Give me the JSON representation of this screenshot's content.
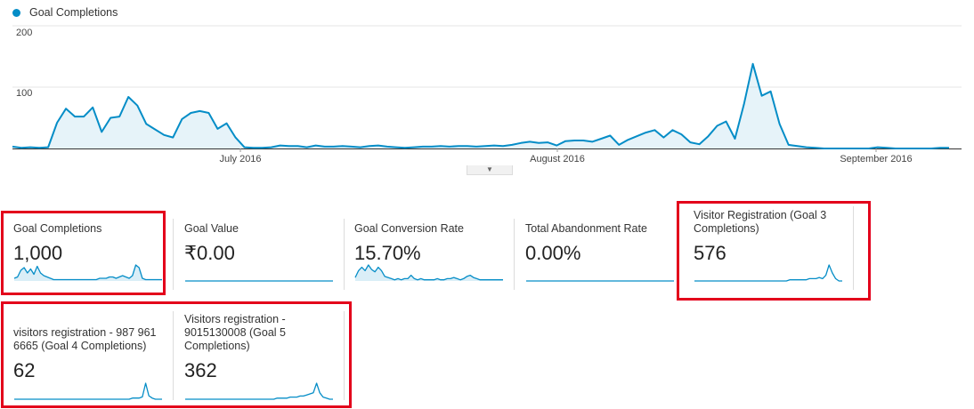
{
  "legend": {
    "label": "Goal Completions",
    "color": "#058dc7"
  },
  "chart_data": {
    "type": "area",
    "series": [
      {
        "name": "Goal Completions",
        "values": [
          3,
          1,
          2,
          1,
          2,
          42,
          65,
          52,
          52,
          67,
          27,
          50,
          52,
          84,
          70,
          40,
          31,
          22,
          18,
          48,
          58,
          61,
          58,
          32,
          41,
          18,
          2,
          1,
          1,
          2,
          5,
          4,
          4,
          2,
          5,
          3,
          3,
          4,
          3,
          2,
          4,
          5,
          3,
          2,
          1,
          2,
          3,
          3,
          4,
          3,
          4,
          4,
          3,
          4,
          5,
          4,
          6,
          9,
          11,
          9,
          10,
          5,
          12,
          13,
          13,
          11,
          16,
          21,
          6,
          14,
          20,
          26,
          30,
          18,
          30,
          23,
          10,
          7,
          20,
          37,
          44,
          16,
          72,
          138,
          86,
          93,
          40,
          6,
          4,
          2,
          1,
          0,
          0,
          0,
          0,
          0,
          0,
          2,
          1,
          0,
          0,
          0,
          0,
          0,
          1,
          1
        ]
      }
    ],
    "x_ticks": [
      "July 2016",
      "August 2016",
      "September 2016"
    ],
    "y_ticks": [
      "200",
      "100"
    ],
    "ylim": [
      0,
      200
    ]
  },
  "metrics": [
    {
      "label": "Goal Completions",
      "value": "1,000"
    },
    {
      "label": "Goal Value",
      "value": "₹0.00"
    },
    {
      "label": "Goal Conversion Rate",
      "value": "15.70%"
    },
    {
      "label": "Total Abandonment Rate",
      "value": "0.00%"
    },
    {
      "label": "Visitor Registration (Goal 3 Completions)",
      "value": "576"
    },
    {
      "label": "visitors registration - 987 961 6665 (Goal 4 Completions)",
      "value": "62"
    },
    {
      "label": "Visitors registration - 9015130008 (Goal 5 Completions)",
      "value": "362"
    }
  ],
  "sparklines": [
    {
      "type": "area",
      "values": [
        2,
        3,
        8,
        10,
        6,
        9,
        5,
        11,
        6,
        4,
        3,
        2,
        1,
        1,
        1,
        1,
        1,
        1,
        1,
        1,
        1,
        1,
        1,
        1,
        1,
        1,
        2,
        2,
        2,
        3,
        3,
        2,
        3,
        4,
        3,
        2,
        4,
        12,
        10,
        2,
        1,
        1,
        1,
        1,
        1,
        1
      ]
    },
    {
      "type": "line",
      "values": [
        0,
        0,
        0,
        0,
        0,
        0,
        0,
        0,
        0,
        0,
        0,
        0,
        0,
        0,
        0,
        0,
        0,
        0,
        0,
        0,
        0,
        0,
        0,
        0,
        0,
        0,
        0,
        0,
        0,
        0,
        0,
        0,
        0,
        0,
        0,
        0,
        0,
        0,
        0,
        0,
        0,
        0,
        0,
        0,
        0,
        0
      ]
    },
    {
      "type": "area",
      "values": [
        3,
        9,
        12,
        9,
        14,
        10,
        8,
        12,
        9,
        4,
        3,
        2,
        1,
        2,
        1,
        2,
        2,
        5,
        2,
        1,
        2,
        1,
        1,
        1,
        1,
        2,
        1,
        1,
        2,
        2,
        3,
        2,
        1,
        2,
        4,
        5,
        3,
        2,
        1,
        1,
        1,
        1,
        1,
        1,
        1,
        1
      ]
    },
    {
      "type": "line",
      "values": [
        0,
        0,
        0,
        0,
        0,
        0,
        0,
        0,
        0,
        0,
        0,
        0,
        0,
        0,
        0,
        0,
        0,
        0,
        0,
        0,
        0,
        0,
        0,
        0,
        0,
        0,
        0,
        0,
        0,
        0,
        0,
        0,
        0,
        0,
        0,
        0,
        0,
        0,
        0,
        0,
        0,
        0,
        0,
        0,
        0,
        0
      ]
    },
    {
      "type": "line",
      "values": [
        0,
        0,
        0,
        0,
        0,
        0,
        0,
        0,
        0,
        0,
        0,
        0,
        0,
        0,
        0,
        0,
        0,
        0,
        0,
        0,
        0,
        0,
        0,
        0,
        0,
        0,
        0,
        0,
        0,
        1,
        1,
        1,
        1,
        1,
        1,
        2,
        2,
        2,
        3,
        2,
        5,
        14,
        7,
        2,
        0,
        0
      ]
    },
    {
      "type": "line",
      "values": [
        0,
        0,
        0,
        0,
        0,
        0,
        0,
        0,
        0,
        0,
        0,
        0,
        0,
        0,
        0,
        0,
        0,
        0,
        0,
        0,
        0,
        0,
        0,
        0,
        0,
        0,
        0,
        0,
        0,
        0,
        0,
        0,
        0,
        0,
        0,
        0,
        1,
        1,
        1,
        2,
        14,
        3,
        1,
        0,
        0,
        0
      ]
    },
    {
      "type": "line",
      "values": [
        0,
        0,
        0,
        0,
        0,
        0,
        0,
        0,
        0,
        0,
        0,
        0,
        0,
        0,
        0,
        0,
        0,
        0,
        0,
        0,
        0,
        0,
        0,
        0,
        0,
        0,
        0,
        0,
        1,
        1,
        1,
        1,
        2,
        2,
        2,
        3,
        3,
        4,
        5,
        6,
        15,
        6,
        2,
        1,
        0,
        0
      ]
    }
  ]
}
